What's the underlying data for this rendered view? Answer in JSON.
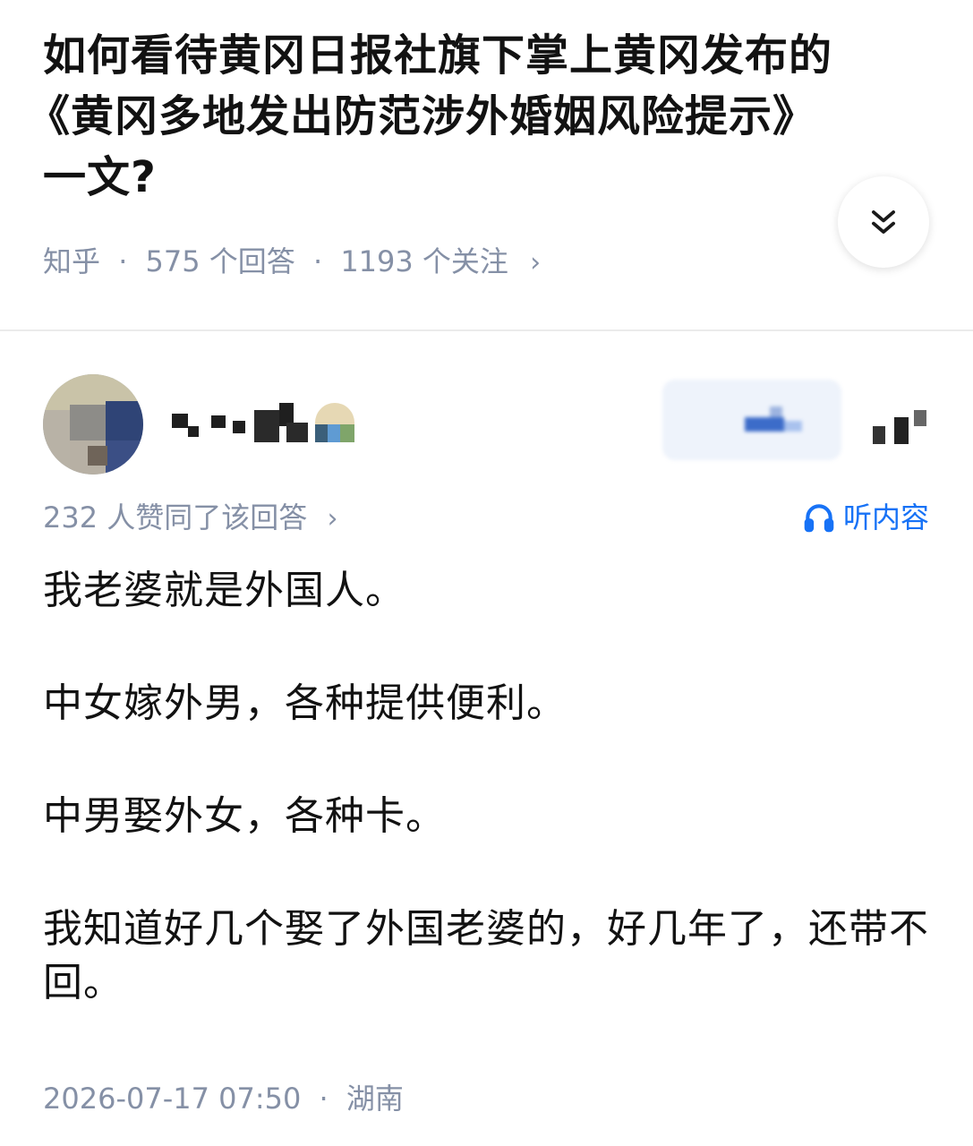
{
  "question": {
    "title_line1": "如何看待黄冈日报社旗下掌上黄冈发布的",
    "title_line2": "《黄冈多地发出防范涉外婚姻风险提示》",
    "title_line3": "一文?",
    "source": "知乎",
    "answer_count": "575 个回答",
    "follow_count": "1193 个关注",
    "separator": "·",
    "chevron": "›"
  },
  "answer": {
    "votes_text": "232 人赞同了该回答",
    "listen_label": "听内容",
    "paragraphs": [
      "我老婆就是外国人。",
      "中女嫁外男，各种提供便利。",
      "中男娶外女，各种卡。",
      "我知道好几个娶了外国老婆的，好几年了，还带不回。"
    ],
    "date": "2026-07-17 07:50",
    "location": "湖南"
  },
  "icons": {
    "expand": "double-chevron-down-icon",
    "listen": "headphones-icon",
    "more": "chevron-right-icon"
  },
  "colors": {
    "meta_gray": "#8590a6",
    "link_blue": "#1772f6",
    "title_text": "#121212"
  }
}
